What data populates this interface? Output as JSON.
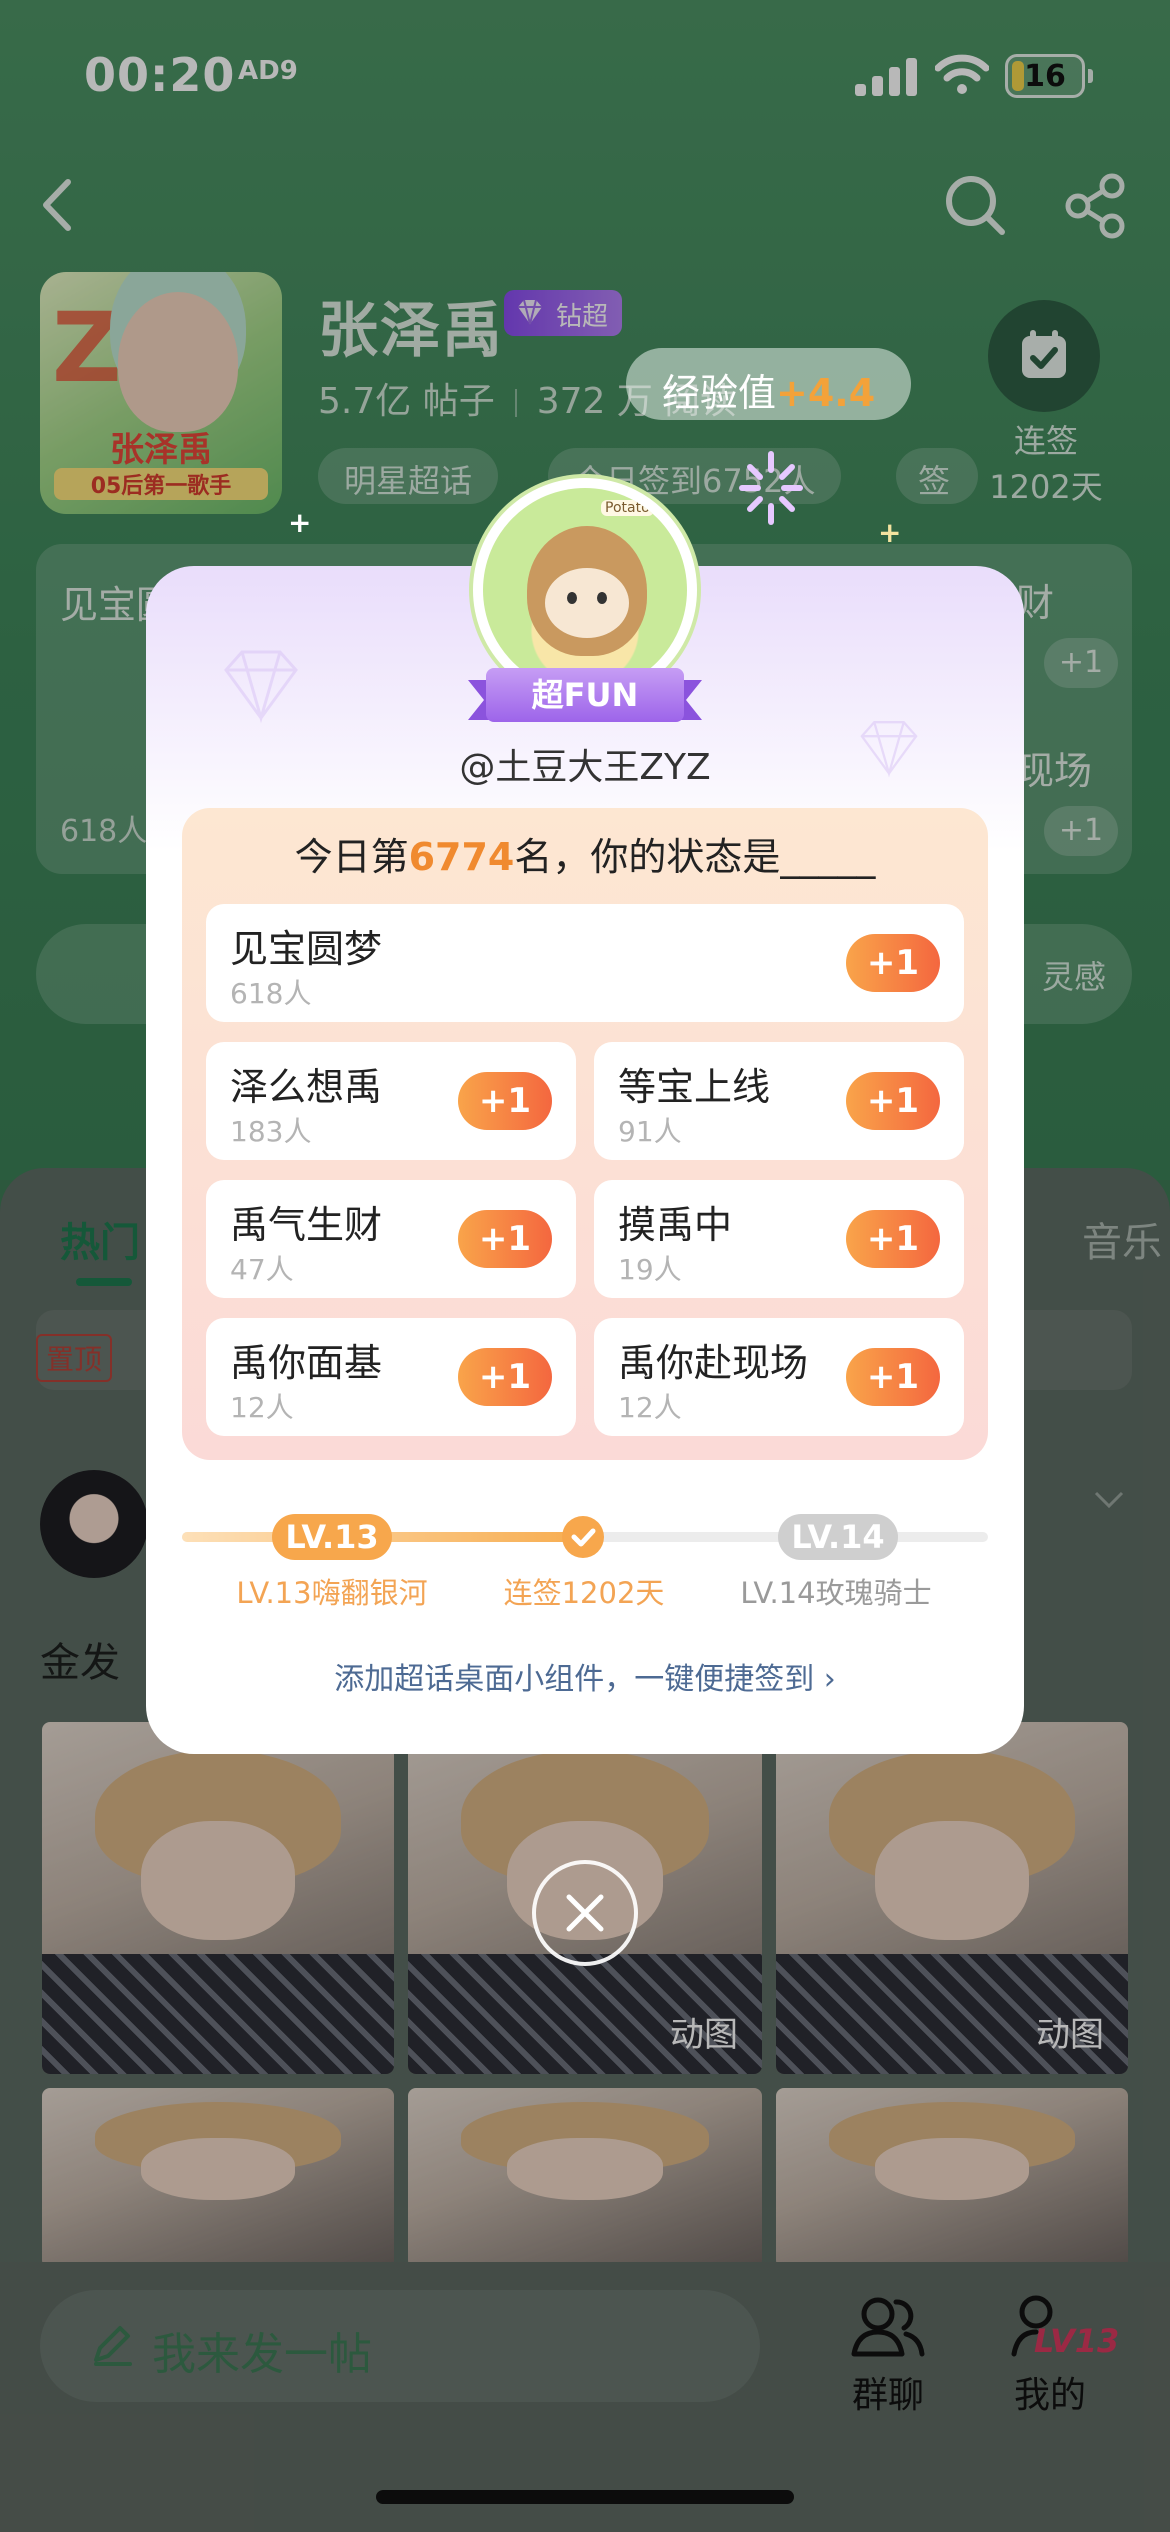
{
  "status_bar": {
    "time": "00:20",
    "ad_badge": "AD9",
    "battery": "16"
  },
  "topic": {
    "name": "张泽禹",
    "badge": "钻超",
    "posts": "5.7亿 帖子",
    "followers": "372 万 阅读",
    "chips": [
      "明星超话",
      "今日签到6752人",
      "签到"
    ],
    "cover_big": "Z",
    "cover_caption1": "张泽禹",
    "cover_caption2": "05后第一歌手"
  },
  "signin": {
    "streak_label": "连签",
    "streak_days": "1202天"
  },
  "exp": {
    "label": "经验值",
    "value": "+4.4"
  },
  "bg_card": {
    "left_title": "见宝圆",
    "right_title1": "财",
    "right_title2": "现场",
    "left_count": "618人",
    "plus": "+1",
    "plus2": "+1"
  },
  "bg_search": {
    "right_text": "灵感"
  },
  "lower_tabs": {
    "hot": "热门",
    "music": "音乐",
    "pinned": "置顶"
  },
  "post": {
    "title": "金发"
  },
  "photos": {
    "gif_tag": "动图"
  },
  "bottom_bar": {
    "compose_placeholder": "我来发一帖",
    "group_chat": "群聊",
    "mine": "我的",
    "level_badge": "LV13"
  },
  "modal": {
    "rank_badge": "超FUN",
    "avatar_tag": "Potato",
    "username": "@土豆大王ZYZ",
    "status_prefix": "今日第",
    "rank_number": "6774",
    "status_suffix": "名，你的状态是_____",
    "options": [
      {
        "name": "见宝圆梦",
        "count": "618人",
        "plus": "+1"
      },
      {
        "name": "泽么想禹",
        "count": "183人",
        "plus": "+1"
      },
      {
        "name": "等宝上线",
        "count": "91人",
        "plus": "+1"
      },
      {
        "name": "禹气生财",
        "count": "47人",
        "plus": "+1"
      },
      {
        "name": "摸禹中",
        "count": "19人",
        "plus": "+1"
      },
      {
        "name": "禹你面基",
        "count": "12人",
        "plus": "+1"
      },
      {
        "name": "禹你赴现场",
        "count": "12人",
        "plus": "+1"
      }
    ],
    "level": {
      "current_pill": "LV.13",
      "next_pill": "LV.14",
      "current_label": "LV.13嗨翻银河",
      "streak_label": "连签1202天",
      "next_label": "LV.14玫瑰骑士",
      "progress": 0.5
    },
    "widget_link": "添加超话桌面小组件，一键便捷签到 ›"
  },
  "colors": {
    "accent_orange": "#f08a2f",
    "brand_green": "#1e7a4f",
    "purple": "#9d64ea",
    "level_grey": "#cfcfcf"
  }
}
